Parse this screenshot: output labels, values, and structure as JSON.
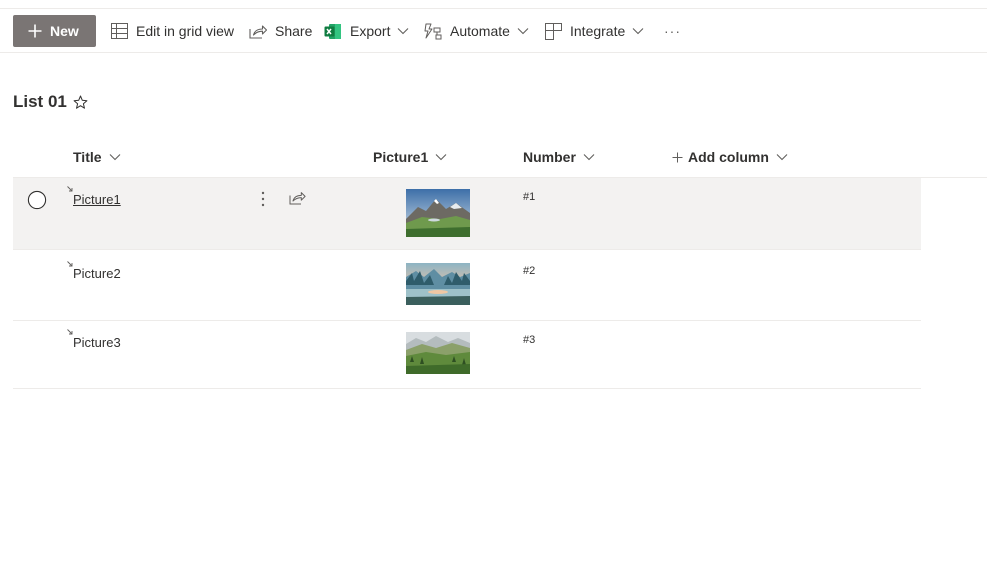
{
  "toolbar": {
    "new_label": "New",
    "edit_grid_label": "Edit in grid view",
    "share_label": "Share",
    "export_label": "Export",
    "automate_label": "Automate",
    "integrate_label": "Integrate",
    "more_label": "···"
  },
  "list": {
    "title": "List 01"
  },
  "columns": {
    "title": "Title",
    "picture": "Picture1",
    "number": "Number",
    "add": "Add column"
  },
  "rows": [
    {
      "title": "Picture1",
      "number": "#1",
      "selected": true
    },
    {
      "title": "Picture2",
      "number": "#2",
      "selected": false
    },
    {
      "title": "Picture3",
      "number": "#3",
      "selected": false
    }
  ],
  "colors": {
    "new_button_bg": "#7a7574",
    "selected_row_bg": "#f3f2f1",
    "excel_green": "#107c41",
    "divider": "#edebe9"
  },
  "icons": [
    "plus-icon",
    "grid-icon",
    "share-icon",
    "excel-icon",
    "automate-icon",
    "integrate-icon",
    "chevron-down-icon",
    "star-icon",
    "checkbox-circle-icon",
    "more-vertical-icon",
    "file-new-icon"
  ]
}
